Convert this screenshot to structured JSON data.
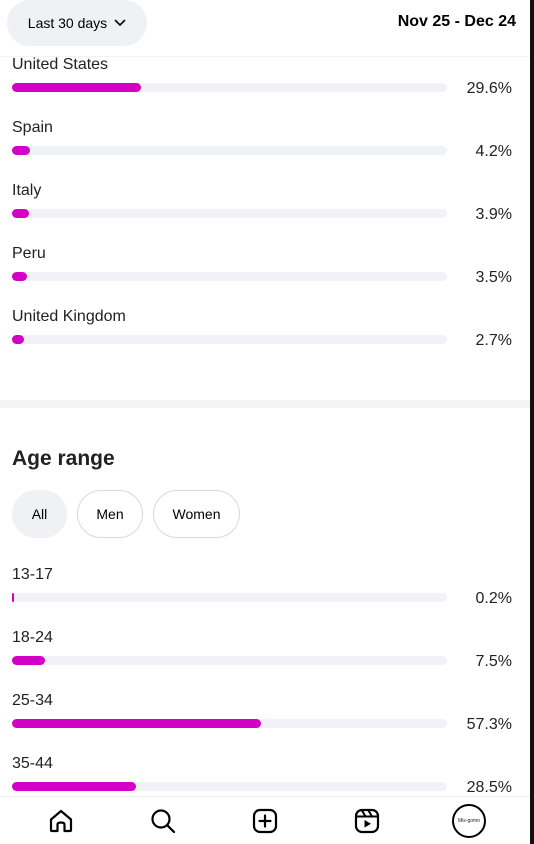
{
  "header": {
    "period_label": "Last 30 days",
    "date_range": "Nov 25 - Dec 24"
  },
  "countries": [
    {
      "label": "United States",
      "percent": 29.6,
      "percent_text": "29.6%"
    },
    {
      "label": "Spain",
      "percent": 4.2,
      "percent_text": "4.2%"
    },
    {
      "label": "Italy",
      "percent": 3.9,
      "percent_text": "3.9%"
    },
    {
      "label": "Peru",
      "percent": 3.5,
      "percent_text": "3.5%"
    },
    {
      "label": "United Kingdom",
      "percent": 2.7,
      "percent_text": "2.7%"
    }
  ],
  "age_section": {
    "title": "Age range",
    "filters": {
      "all": "All",
      "men": "Men",
      "women": "Women"
    },
    "selected_filter": "All",
    "ranges": [
      {
        "label": "13-17",
        "percent": 0.2,
        "percent_text": "0.2%"
      },
      {
        "label": "18-24",
        "percent": 7.5,
        "percent_text": "7.5%"
      },
      {
        "label": "25-34",
        "percent": 57.3,
        "percent_text": "57.3%"
      },
      {
        "label": "35-44",
        "percent": 28.5,
        "percent_text": "28.5%"
      }
    ]
  },
  "nav": {
    "items": [
      "home-icon",
      "search-icon",
      "create-icon",
      "reels-icon",
      "profile-avatar"
    ],
    "avatar_text": "Mis-gomo"
  },
  "colors": {
    "accent": "#d300c5",
    "track": "#f1f2f5",
    "chip_active": "#eff1f4"
  }
}
